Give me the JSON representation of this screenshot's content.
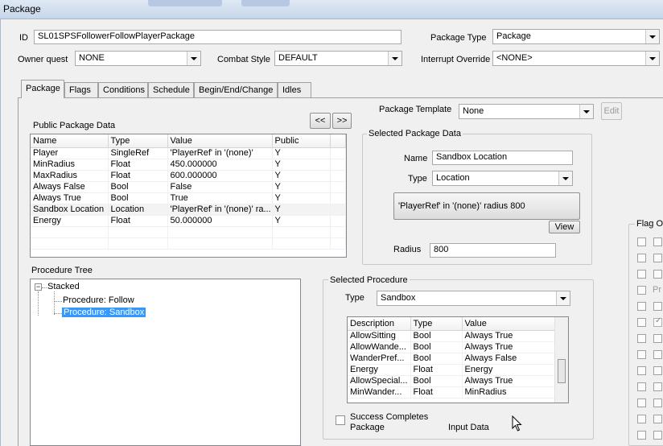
{
  "window": {
    "title": "Package"
  },
  "header": {
    "id_label": "ID",
    "id_value": "SL01SPSFollowerFollowPlayerPackage",
    "owner_quest_label": "Owner quest",
    "owner_quest_value": "NONE",
    "combat_style_label": "Combat Style",
    "combat_style_value": "DEFAULT",
    "package_type_label": "Package Type",
    "package_type_value": "Package",
    "interrupt_override_label": "Interrupt Override",
    "interrupt_override_value": "<NONE>"
  },
  "tabs": [
    "Package",
    "Flags",
    "Conditions",
    "Schedule",
    "Begin/End/Change",
    "Idles"
  ],
  "public_data": {
    "label": "Public Package Data",
    "prev_label": "<<",
    "next_label": ">>",
    "columns": [
      "Name",
      "Type",
      "Value",
      "Public"
    ],
    "rows": [
      [
        "Player",
        "SingleRef",
        "'PlayerRef' in '(none)'",
        "Y"
      ],
      [
        "MinRadius",
        "Float",
        "450.000000",
        "Y"
      ],
      [
        "MaxRadius",
        "Float",
        "600.000000",
        "Y"
      ],
      [
        "Always False",
        "Bool",
        "False",
        "Y"
      ],
      [
        "Always True",
        "Bool",
        "True",
        "Y"
      ],
      [
        "Sandbox Location",
        "Location",
        "'PlayerRef' in '(none)' ra...",
        "Y"
      ],
      [
        "Energy",
        "Float",
        "50.000000",
        "Y"
      ]
    ]
  },
  "template": {
    "label": "Package Template",
    "value": "None",
    "edit_label": "Edit"
  },
  "selected_data": {
    "label": "Selected Package Data",
    "name_label": "Name",
    "name_value": "Sandbox Location",
    "type_label": "Type",
    "type_value": "Location",
    "location_text": "'PlayerRef' in '(none)' radius 800",
    "view_label": "View",
    "radius_label": "Radius",
    "radius_value": "800"
  },
  "procedure_tree": {
    "label": "Procedure Tree",
    "root": "Stacked",
    "expander": "−",
    "children": [
      "Procedure: Follow",
      "Procedure: Sandbox"
    ]
  },
  "selected_procedure": {
    "label": "Selected Procedure",
    "type_label": "Type",
    "type_value": "Sandbox",
    "columns": [
      "Description",
      "Type",
      "Value"
    ],
    "rows": [
      [
        "AllowSitting",
        "Bool",
        "Always True"
      ],
      [
        "AllowWande...",
        "Bool",
        "Always True"
      ],
      [
        "WanderPref...",
        "Bool",
        "Always False"
      ],
      [
        "Energy",
        "Float",
        "Energy"
      ],
      [
        "AllowSpecial...",
        "Bool",
        "Always True"
      ],
      [
        "MinWander...",
        "Float",
        "MinRadius"
      ]
    ],
    "success_label_1": "Success Completes",
    "success_label_2": "Package",
    "input_data_label": "Input Data"
  },
  "flags_panel": {
    "label": "Flag O",
    "partial_text": "Pr"
  },
  "colors": {
    "selection": "#3399ff",
    "title_bar": "#c6d6ea"
  }
}
